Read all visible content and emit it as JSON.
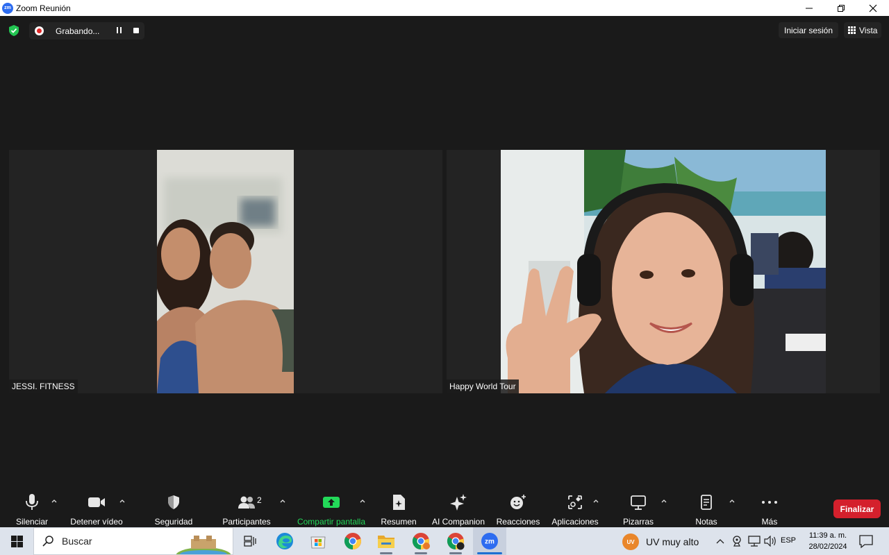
{
  "window": {
    "title": "Zoom Reunión",
    "app_icon_text": "zm"
  },
  "topbar": {
    "recording_label": "Grabando...",
    "signin_label": "Iniciar sesión",
    "view_label": "Vista"
  },
  "participants": [
    {
      "name": "JESSI. FITNESS"
    },
    {
      "name": "Happy World Tour"
    }
  ],
  "toolbar": {
    "mute_label": "Silenciar",
    "video_label": "Detener vídeo",
    "security_label": "Seguridad",
    "participants_label": "Participantes",
    "participants_count": "2",
    "share_label": "Compartir pantalla",
    "summary_label": "Resumen",
    "ai_label": "AI Companion",
    "reactions_label": "Reacciones",
    "apps_label": "Aplicaciones",
    "whiteboards_label": "Pizarras",
    "notes_label": "Notas",
    "more_label": "Más",
    "end_label": "Finalizar"
  },
  "taskbar": {
    "search_placeholder": "Buscar",
    "weather_badge": "UV",
    "weather_text": "UV muy alto",
    "language": "ESP",
    "time": "11:39 a. m.",
    "date": "28/02/2024",
    "zoom_icon_text": "zm"
  },
  "colors": {
    "share_green": "#23d959",
    "end_red": "#d4202c",
    "recording_red": "#e02828",
    "zoom_blue": "#2d6cf0"
  }
}
